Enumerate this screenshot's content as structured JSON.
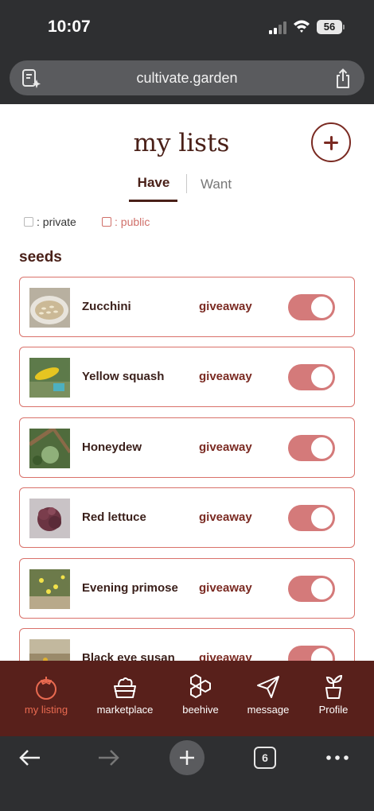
{
  "status_bar": {
    "time": "10:07",
    "battery": "56"
  },
  "browser": {
    "url": "cultivate.garden",
    "tab_count": "6"
  },
  "header": {
    "title": "my lists"
  },
  "tabs": [
    {
      "label": "Have",
      "active": true
    },
    {
      "label": "Want",
      "active": false
    }
  ],
  "legend": {
    "private": ": private",
    "public": ": public"
  },
  "section": {
    "title": "seeds"
  },
  "items": [
    {
      "name": "Zucchini",
      "status": "giveaway",
      "toggle_on": true
    },
    {
      "name": "Yellow squash",
      "status": "giveaway",
      "toggle_on": true
    },
    {
      "name": "Honeydew",
      "status": "giveaway",
      "toggle_on": true
    },
    {
      "name": "Red lettuce",
      "status": "giveaway",
      "toggle_on": true
    },
    {
      "name": "Evening primose",
      "status": "giveaway",
      "toggle_on": true
    },
    {
      "name": "Black eye susan",
      "status": "giveaway",
      "toggle_on": true
    }
  ],
  "bottom_nav": [
    {
      "label": "my listing",
      "icon": "tomato-icon",
      "active": true
    },
    {
      "label": "marketplace",
      "icon": "market-basket-icon",
      "active": false
    },
    {
      "label": "beehive",
      "icon": "honeycomb-icon",
      "active": false
    },
    {
      "label": "message",
      "icon": "paper-plane-icon",
      "active": false
    },
    {
      "label": "Profile",
      "icon": "sprout-pot-icon",
      "active": false
    }
  ],
  "colors": {
    "accent": "#d9716a",
    "brand_dark": "#58201b",
    "toggle": "#d47a7a",
    "active_nav": "#e96a50"
  }
}
